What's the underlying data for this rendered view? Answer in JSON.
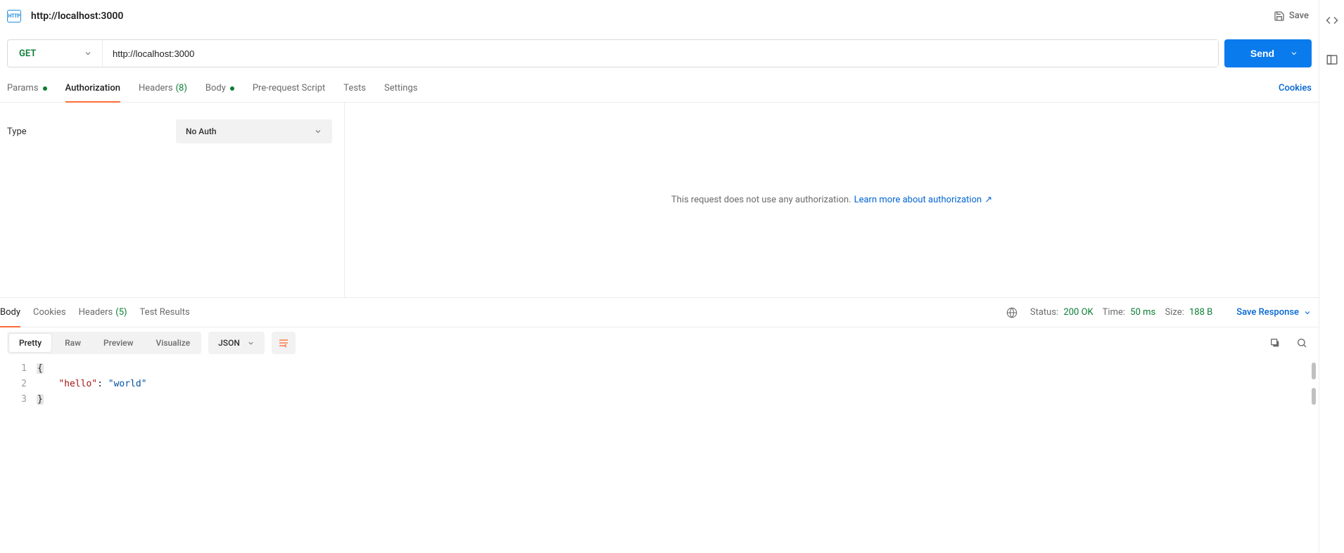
{
  "title": "http://localhost:3000",
  "save_label": "Save",
  "request": {
    "method": "GET",
    "url": "http://localhost:3000"
  },
  "send_label": "Send",
  "req_tabs": {
    "params": "Params",
    "authorization": "Authorization",
    "headers": "Headers",
    "headers_count": "(8)",
    "body": "Body",
    "prerequest": "Pre-request Script",
    "tests": "Tests",
    "settings": "Settings",
    "cookies": "Cookies"
  },
  "auth": {
    "type_label": "Type",
    "selected": "No Auth",
    "message": "This request does not use any authorization.",
    "learn_link": "Learn more about authorization",
    "ext_arrow": "↗"
  },
  "resp_tabs": {
    "body": "Body",
    "cookies": "Cookies",
    "headers": "Headers",
    "headers_count": "(5)",
    "tests": "Test Results"
  },
  "resp_meta": {
    "status_label": "Status:",
    "status_value": "200 OK",
    "time_label": "Time:",
    "time_value": "50 ms",
    "size_label": "Size:",
    "size_value": "188 B",
    "save_response": "Save Response"
  },
  "body_view": {
    "pretty": "Pretty",
    "raw": "Raw",
    "preview": "Preview",
    "visualize": "Visualize",
    "format": "JSON"
  },
  "code": {
    "ln1": "1",
    "ln2": "2",
    "ln3": "3",
    "brace_open": "{",
    "indent": "    ",
    "key": "\"hello\"",
    "colon": ": ",
    "val": "\"world\"",
    "brace_close": "}"
  }
}
